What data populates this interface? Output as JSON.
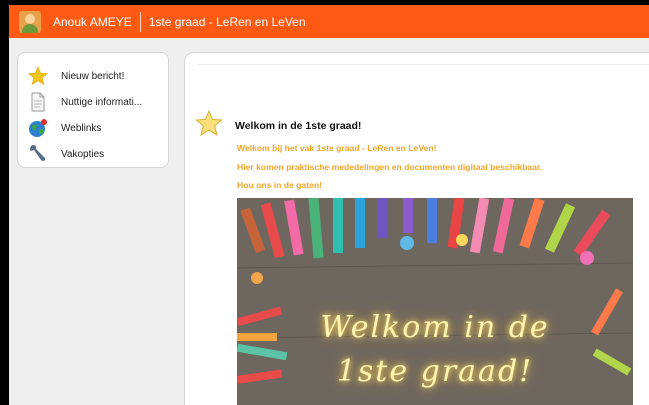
{
  "header": {
    "user_name": "Anouk AMEYE",
    "course_title": "1ste graad - LeRen en LeVen",
    "accent_color": "#ff5a14"
  },
  "sidebar": {
    "items": [
      {
        "label": "Nieuw bericht!",
        "icon": "star-icon"
      },
      {
        "label": "Nuttige informati...",
        "icon": "document-icon"
      },
      {
        "label": "Weblinks",
        "icon": "globe-icon"
      },
      {
        "label": "Vakopties",
        "icon": "wrench-icon"
      }
    ]
  },
  "main": {
    "title": "Welkom in de 1ste graad!",
    "messages": [
      "Welkom bij het vak 1ste graad - LeRen en LeVen!",
      "Hier komen praktische mededelingen en documenten digitaal beschikbaar.",
      "Hou ons in de gaten!"
    ],
    "message_color": "#f2a62e",
    "banner": {
      "line1": "Welkom in de",
      "line2": "1ste graad!"
    }
  }
}
